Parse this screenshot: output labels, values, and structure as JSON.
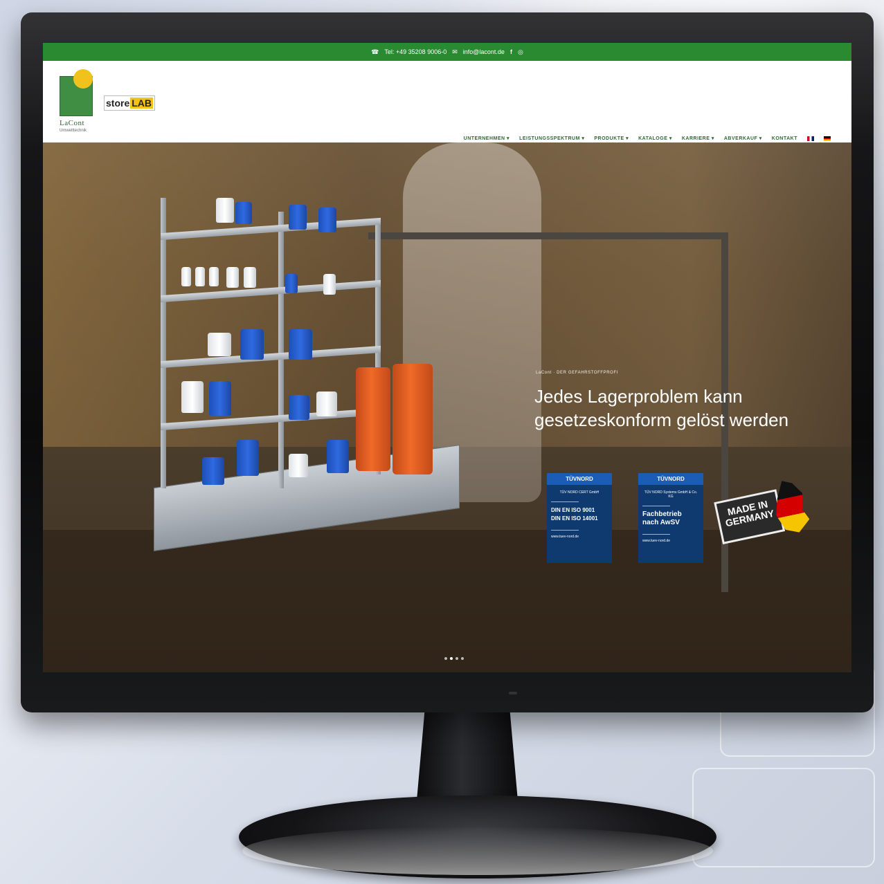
{
  "topbar": {
    "phone": "Tel: +49 35208 9006-0",
    "email": "info@lacont.de",
    "facebook_icon": "facebook-icon",
    "instagram_icon": "instagram-icon",
    "color": "#2a8a32"
  },
  "logo": {
    "name": "LaCont",
    "subtitle": "Umwelttechnik",
    "partner_store": "store",
    "partner_lab": "LAB"
  },
  "nav": {
    "items": [
      {
        "label": "UNTERNEHMEN"
      },
      {
        "label": "LEISTUNGSSPEKTRUM"
      },
      {
        "label": "PRODUKTE"
      },
      {
        "label": "KATALOGE"
      },
      {
        "label": "KARRIERE"
      },
      {
        "label": "ABVERKAUF"
      },
      {
        "label": "KONTAKT"
      }
    ],
    "languages": [
      "en",
      "de"
    ]
  },
  "hero": {
    "kicker": "LaCont · DER GEFAHRSTOFFPROFI",
    "headline": "Jedes Lagerproblem kann gesetzeskonform gelöst werden",
    "certificates": [
      {
        "brand": "TÜVNORD",
        "org": "TÜV NORD CERT GmbH",
        "line1": "DIN EN ISO 9001",
        "line2": "DIN EN ISO 14001",
        "url": "www.tuev-nord.de"
      },
      {
        "brand": "TÜVNORD",
        "org": "TÜV NORD Systems GmbH & Co. KG",
        "line1": "Fachbetrieb",
        "line2": "nach AwSV",
        "url": "www.tuev-nord.de"
      }
    ],
    "badge_line1": "MADE IN",
    "badge_line2": "GERMANY",
    "slides": 4,
    "active_slide": 1
  }
}
